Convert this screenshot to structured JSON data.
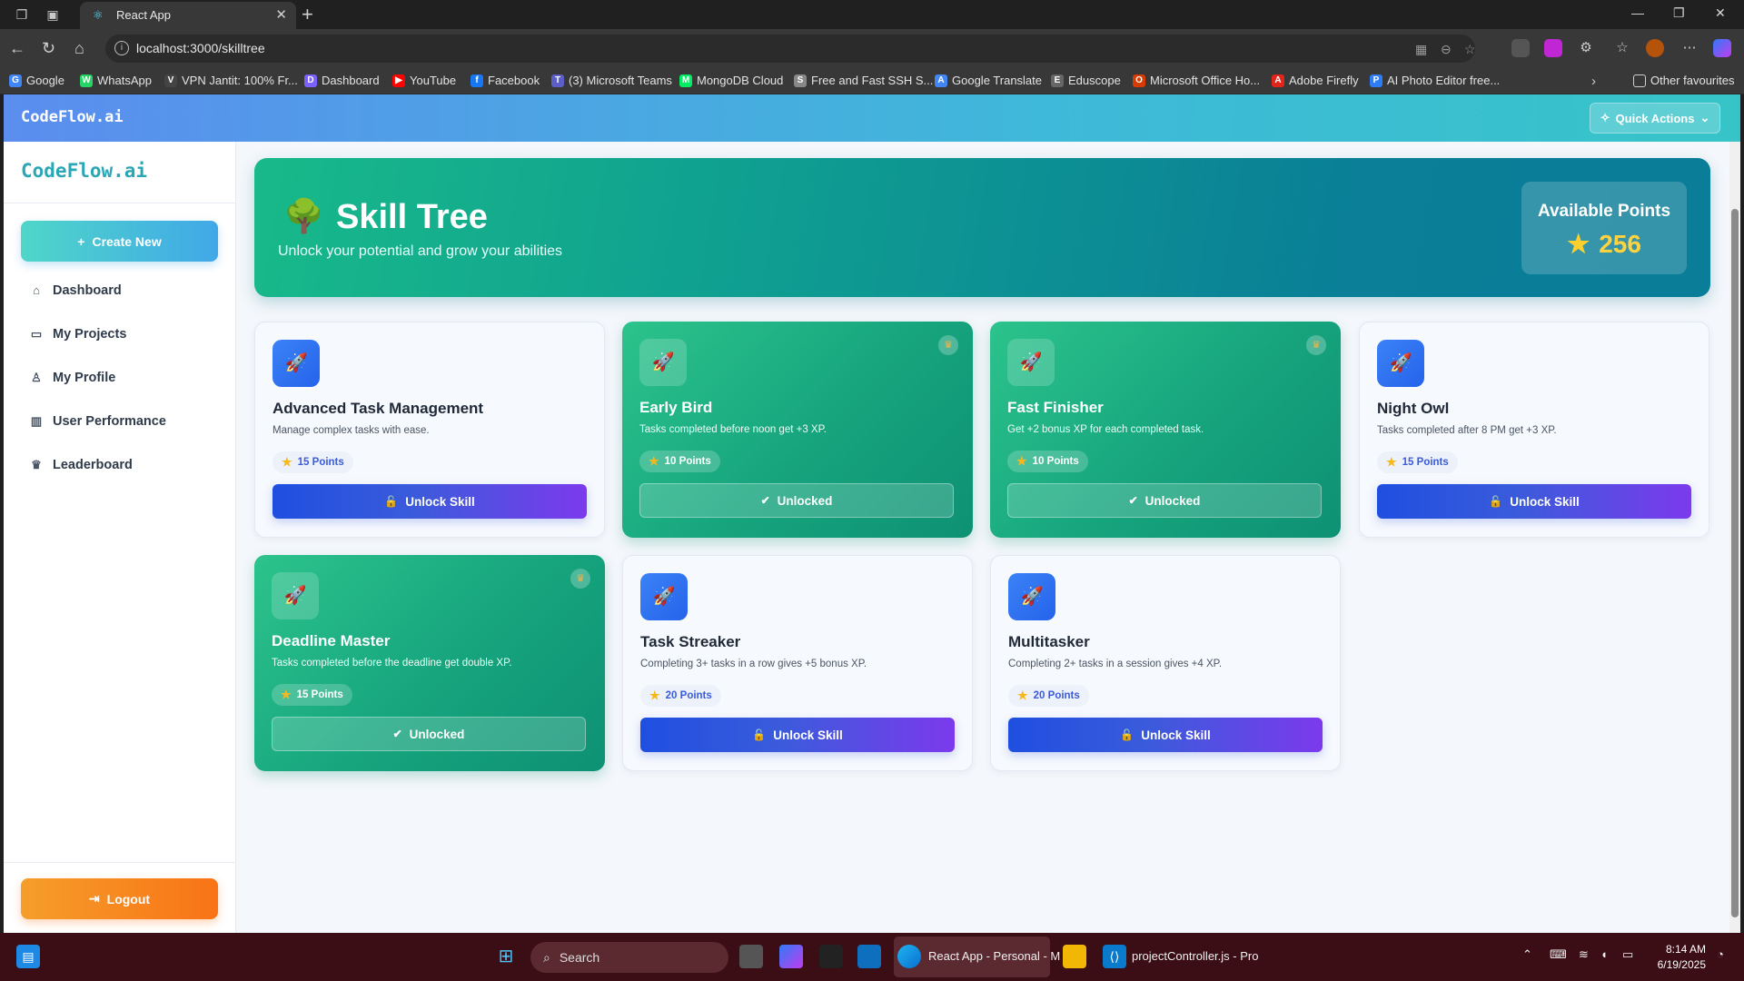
{
  "browser": {
    "tab_title": "React App",
    "url": "localhost:3000/skilltree",
    "bookmarks": [
      {
        "label": "Google",
        "color": "#4285f4",
        "glyph": "G"
      },
      {
        "label": "WhatsApp",
        "color": "#25d366",
        "glyph": "W"
      },
      {
        "label": "VPN Jantit: 100% Fr...",
        "color": "#444444",
        "glyph": "V"
      },
      {
        "label": "Dashboard",
        "color": "#7b61ff",
        "glyph": "D"
      },
      {
        "label": "YouTube",
        "color": "#ff0000",
        "glyph": "▶"
      },
      {
        "label": "Facebook",
        "color": "#1877f2",
        "glyph": "f"
      },
      {
        "label": "(3) Microsoft Teams",
        "color": "#5b5fc7",
        "glyph": "T"
      },
      {
        "label": "MongoDB Cloud",
        "color": "#00ed64",
        "glyph": "M"
      },
      {
        "label": "Free and Fast SSH S...",
        "color": "#888888",
        "glyph": "S"
      },
      {
        "label": "Google Translate",
        "color": "#4285f4",
        "glyph": "A"
      },
      {
        "label": "Eduscope",
        "color": "#666666",
        "glyph": "E"
      },
      {
        "label": "Microsoft Office Ho...",
        "color": "#d83b01",
        "glyph": "O"
      },
      {
        "label": "Adobe Firefly",
        "color": "#e1251b",
        "glyph": "A"
      },
      {
        "label": "AI Photo Editor free...",
        "color": "#2e7cf6",
        "glyph": "P"
      }
    ],
    "other_favourites": "Other favourites"
  },
  "app": {
    "brand": "CodeFlow.ai",
    "quick_actions": "Quick Actions",
    "sidebar": {
      "brand": "CodeFlow.ai",
      "create_new": "Create New",
      "nav": [
        {
          "label": "Dashboard",
          "icon": "home-icon",
          "glyph": "⌂"
        },
        {
          "label": "My Projects",
          "icon": "folder-icon",
          "glyph": "▭"
        },
        {
          "label": "My Profile",
          "icon": "user-icon",
          "glyph": "♙"
        },
        {
          "label": "User Performance",
          "icon": "bar-chart-icon",
          "glyph": "▥"
        },
        {
          "label": "Leaderboard",
          "icon": "trophy-icon",
          "glyph": "♛"
        }
      ],
      "logout": "Logout"
    },
    "hero": {
      "emoji": "🌳",
      "title": "Skill Tree",
      "subtitle": "Unlock your potential and grow your abilities",
      "available_label": "Available Points",
      "available_value": "256"
    },
    "skills": [
      {
        "name": "Advanced Task Management",
        "desc": "Manage complex tasks with ease.",
        "points": "15 Points",
        "status": "locked",
        "button": "Unlock Skill"
      },
      {
        "name": "Early Bird",
        "desc": "Tasks completed before noon get +3 XP.",
        "points": "10 Points",
        "status": "unlocked",
        "button": "Unlocked"
      },
      {
        "name": "Fast Finisher",
        "desc": "Get +2 bonus XP for each completed task.",
        "points": "10 Points",
        "status": "unlocked",
        "button": "Unlocked"
      },
      {
        "name": "Night Owl",
        "desc": "Tasks completed after 8 PM get +3 XP.",
        "points": "15 Points",
        "status": "locked",
        "button": "Unlock Skill"
      },
      {
        "name": "Deadline Master",
        "desc": "Tasks completed before the deadline get double XP.",
        "points": "15 Points",
        "status": "unlocked",
        "button": "Unlocked"
      },
      {
        "name": "Task Streaker",
        "desc": "Completing 3+ tasks in a row gives +5 bonus XP.",
        "points": "20 Points",
        "status": "locked",
        "button": "Unlock Skill"
      },
      {
        "name": "Multitasker",
        "desc": "Completing 2+ tasks in a session gives +4 XP.",
        "points": "20 Points",
        "status": "locked",
        "button": "Unlock Skill"
      }
    ]
  },
  "taskbar": {
    "search": "Search",
    "active_app": "React App - Personal - M",
    "vscode": "projectController.js - Pro",
    "time": "8:14 AM",
    "date": "6/19/2025"
  }
}
